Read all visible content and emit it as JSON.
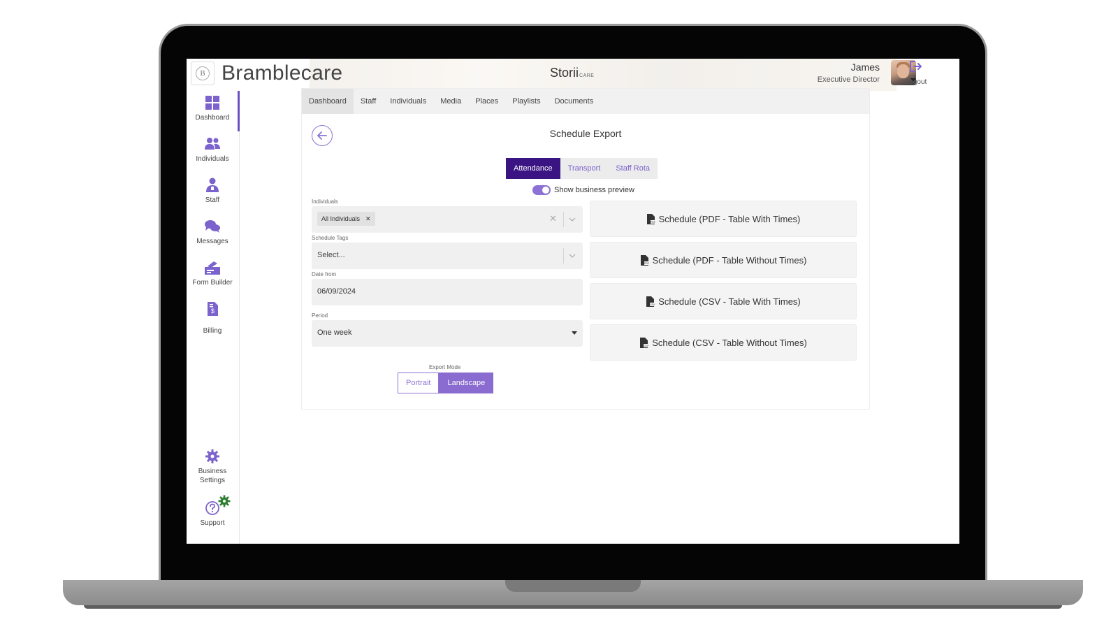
{
  "header": {
    "brand_initial": "B",
    "brand_name": "Bramblecare",
    "product_name": "Storii",
    "product_suffix": "CARE",
    "user_name": "James",
    "user_role": "Executive Director",
    "logout_label": "Logout"
  },
  "sidebar": {
    "items": [
      {
        "label": "Dashboard",
        "icon": "dashboard-icon"
      },
      {
        "label": "Individuals",
        "icon": "individuals-icon"
      },
      {
        "label": "Staff",
        "icon": "staff-icon"
      },
      {
        "label": "Messages",
        "icon": "messages-icon"
      },
      {
        "label": "Form Builder",
        "icon": "form-builder-icon"
      },
      {
        "label": "Billing",
        "icon": "billing-icon"
      }
    ],
    "bottom": [
      {
        "label_line1": "Business",
        "label_line2": "Settings",
        "icon": "gear-icon"
      },
      {
        "label": "Support",
        "icon": "help-icon"
      }
    ]
  },
  "tabs": [
    "Dashboard",
    "Staff",
    "Individuals",
    "Media",
    "Places",
    "Playlists",
    "Documents"
  ],
  "page": {
    "title": "Schedule Export",
    "segments": [
      "Attendance",
      "Transport",
      "Staff Rota"
    ],
    "toggle_label": "Show business preview",
    "toggle_on": true
  },
  "form": {
    "individuals_label": "Individuals",
    "individuals_chip": "All Individuals",
    "schedule_tags_label": "Schedule Tags",
    "schedule_tags_placeholder": "Select...",
    "date_from_label": "Date from",
    "date_from_value": "06/09/2024",
    "period_label": "Period",
    "period_value": "One week",
    "export_mode_label": "Export Mode",
    "export_modes": [
      "Portrait",
      "Landscape"
    ],
    "export_mode_selected": "Landscape"
  },
  "exports": [
    "Schedule (PDF - Table With Times)",
    "Schedule (PDF - Table Without Times)",
    "Schedule (CSV - Table With Times)",
    "Schedule (CSV - Table Without Times)"
  ],
  "colors": {
    "accent": "#8c72d4",
    "accent_dark": "#3a1482",
    "icon": "#7c62cc",
    "badge_green": "#2e7d32"
  }
}
